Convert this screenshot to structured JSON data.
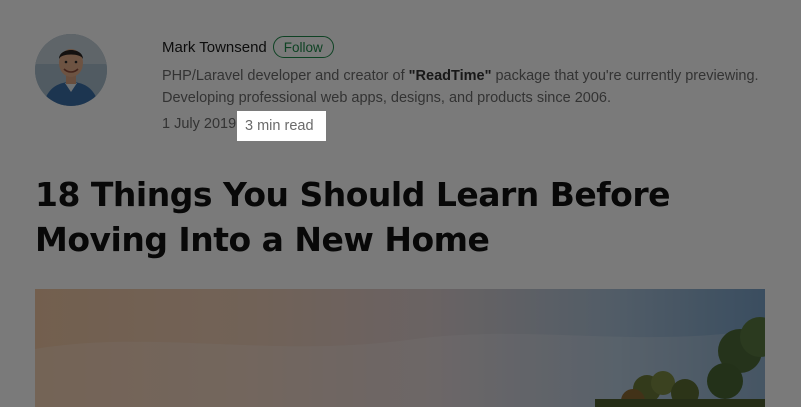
{
  "author": {
    "name": "Mark Townsend",
    "follow_label": "Follow",
    "bio_prefix": "PHP/Laravel developer and creator of ",
    "bio_highlight": "\"ReadTime\"",
    "bio_suffix": " package that you're currently previewing. Developing professional web apps, designs, and products since 2006.",
    "avatar_icon": "avatar-photo-icon"
  },
  "meta": {
    "date": "1 July 2019",
    "separator": " · ",
    "read_time": "3 min read"
  },
  "article": {
    "title": "18 Things You Should Learn Before Moving Into a New Home",
    "hero_image_icon": "house-landscape-photo-icon"
  },
  "colors": {
    "follow_accent": "#1e8a4a",
    "overlay": "rgba(0,0,0,0.52)"
  }
}
